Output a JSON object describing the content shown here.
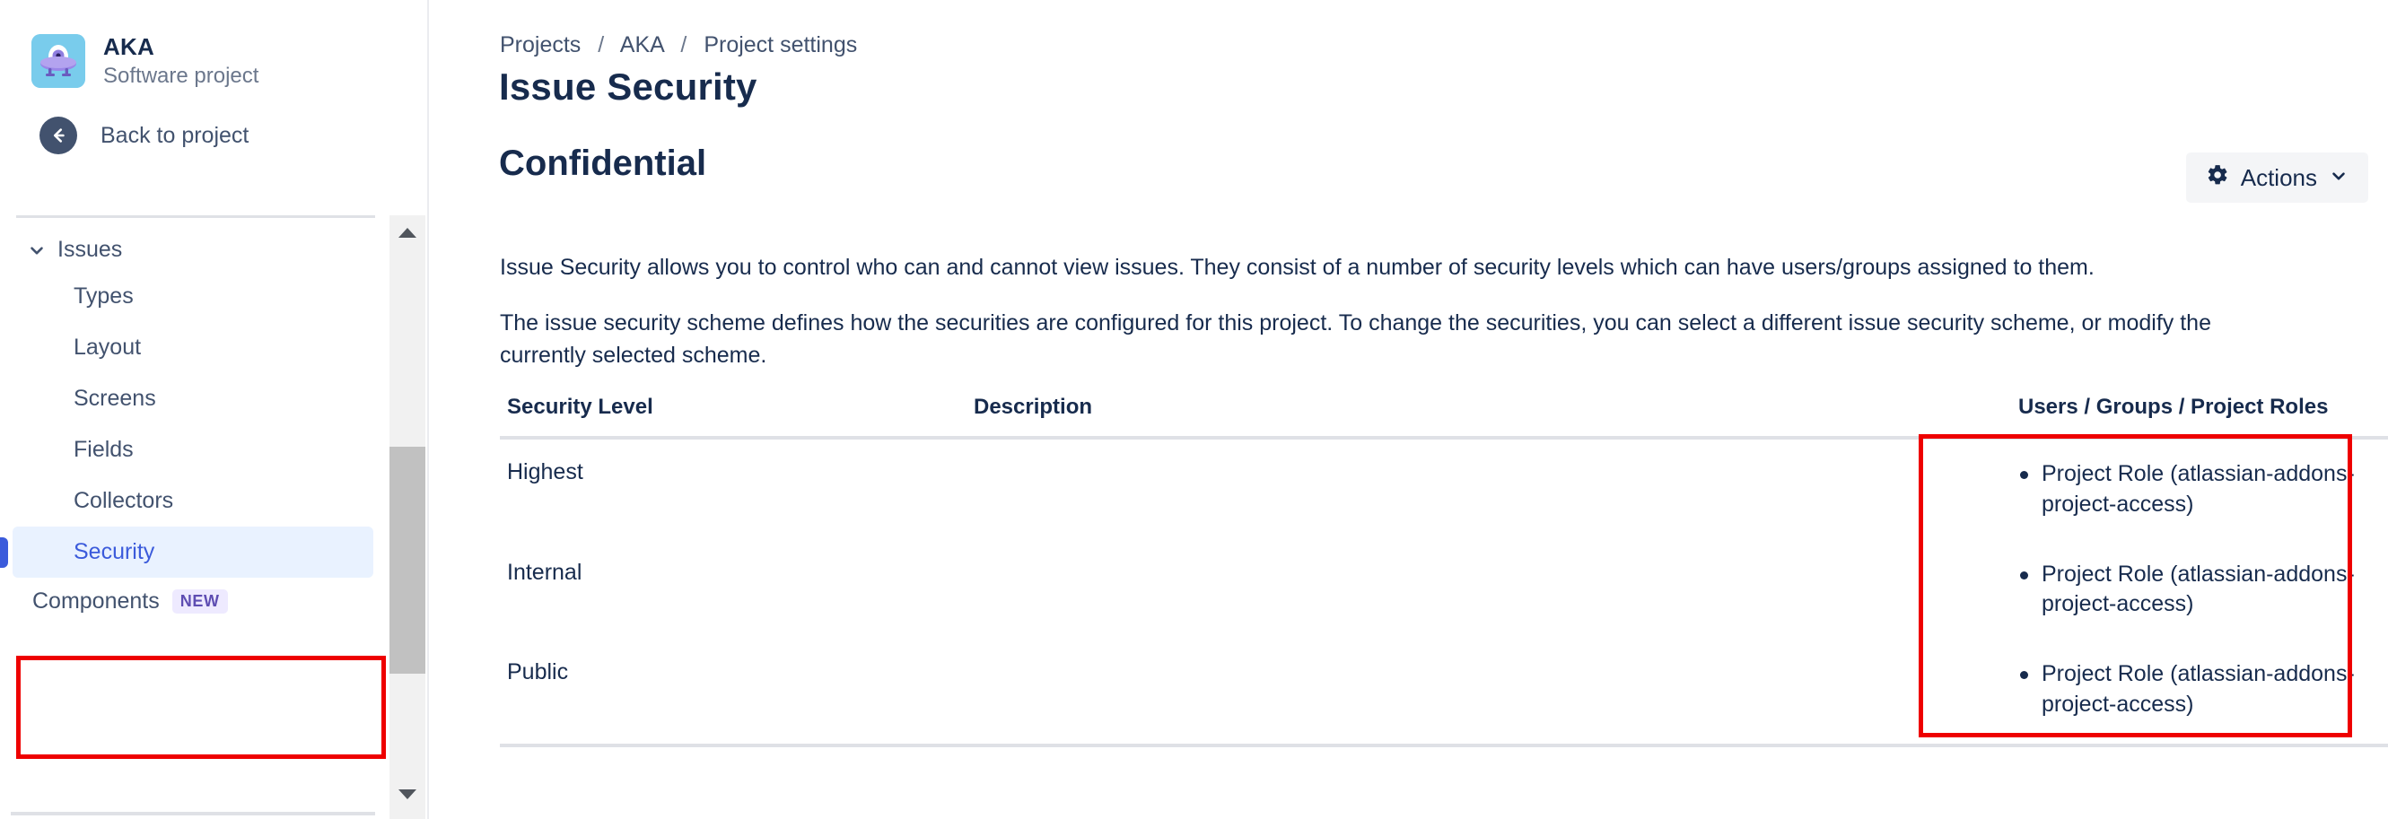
{
  "sidebar": {
    "project": {
      "name": "AKA",
      "type": "Software project",
      "avatar_icon": "ufo-robot-avatar-icon",
      "avatar_bg": "#79ccec"
    },
    "back": {
      "label": "Back to project",
      "icon": "arrow-left-icon"
    },
    "section": {
      "label": "Issues",
      "chevron_icon": "chevron-down-icon",
      "expanded": true
    },
    "items": [
      {
        "label": "Types",
        "selected": false
      },
      {
        "label": "Layout",
        "selected": false
      },
      {
        "label": "Screens",
        "selected": false
      },
      {
        "label": "Fields",
        "selected": false
      },
      {
        "label": "Collectors",
        "selected": false
      },
      {
        "label": "Security",
        "selected": true
      }
    ],
    "components": {
      "label": "Components",
      "badge": "NEW"
    },
    "scrollbar": {
      "up_icon": "triangle-up-icon",
      "down_icon": "triangle-down-icon"
    },
    "selected_accent": "#3b5bdb",
    "selected_bg": "#e9f2ff"
  },
  "main": {
    "breadcrumb": [
      {
        "label": "Projects"
      },
      {
        "label": "AKA"
      },
      {
        "label": "Project settings"
      }
    ],
    "breadcrumb_separator": "/",
    "page_title": "Issue Security",
    "scheme_title": "Confidential",
    "actions_button": {
      "label": "Actions",
      "gear_icon": "gear-icon",
      "chevron_icon": "chevron-down-icon"
    },
    "paragraphs": [
      "Issue Security allows you to control who can and cannot view issues. They consist of a number of security levels which can have users/groups assigned to them.",
      "The issue security scheme defines how the securities are configured for this project. To change the securities, you can select a different issue security scheme, or modify the currently selected scheme."
    ],
    "table": {
      "headers": [
        "Security Level",
        "Description",
        "Users / Groups / Project Roles"
      ],
      "rows": [
        {
          "level": "Highest",
          "description": "",
          "roles": [
            "Project Role (atlassian-addons-project-access)"
          ]
        },
        {
          "level": "Internal",
          "description": "",
          "roles": [
            "Project Role (atlassian-addons-project-access)"
          ]
        },
        {
          "level": "Public",
          "description": "",
          "roles": [
            "Project Role (atlassian-addons-project-access)"
          ]
        }
      ]
    }
  },
  "annotations": {
    "color": "#ee0000",
    "boxes": [
      {
        "name": "security-nav-highlight"
      },
      {
        "name": "project-roles-highlight"
      }
    ]
  }
}
